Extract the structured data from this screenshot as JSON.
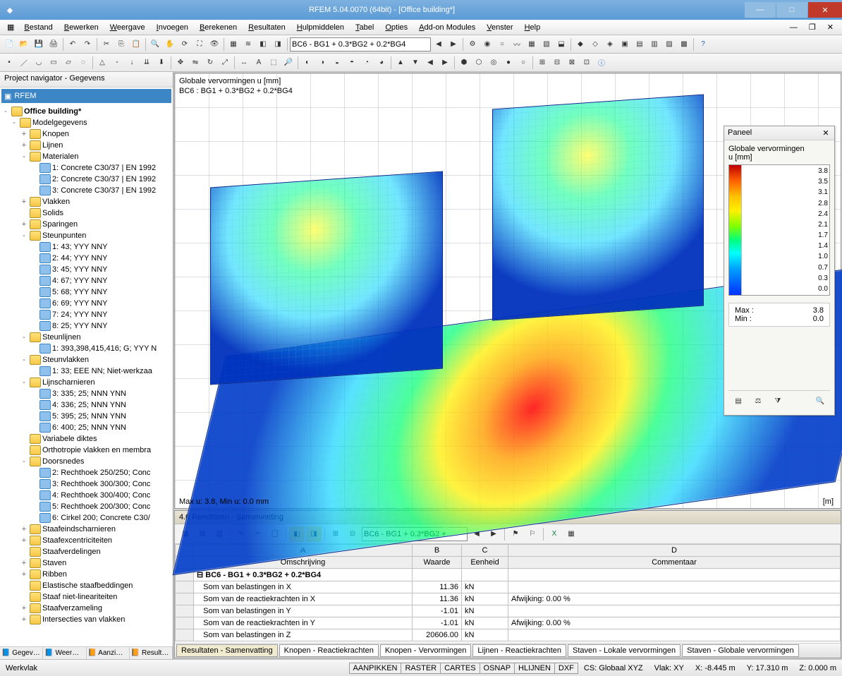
{
  "title": "RFEM 5.04.0070 (64bit) - [Office building*]",
  "menus": [
    "Bestand",
    "Bewerken",
    "Weergave",
    "Invoegen",
    "Berekenen",
    "Resultaten",
    "Hulpmiddelen",
    "Tabel",
    "Opties",
    "Add-on Modules",
    "Venster",
    "Help"
  ],
  "lc_combo": "BC6 - BG1 + 0.3*BG2 + 0.2*BG4",
  "navigator": {
    "title": "Project navigator - Gegevens",
    "root": "RFEM",
    "project": "Office building*",
    "items": [
      {
        "l": 1,
        "exp": "-",
        "ic": "folder",
        "t": "Modelgegevens"
      },
      {
        "l": 2,
        "exp": "+",
        "ic": "folder",
        "t": "Knopen"
      },
      {
        "l": 2,
        "exp": "+",
        "ic": "folder",
        "t": "Lijnen"
      },
      {
        "l": 2,
        "exp": "-",
        "ic": "folder",
        "t": "Materialen"
      },
      {
        "l": 3,
        "exp": "",
        "ic": "nic",
        "t": "1: Concrete C30/37 | EN 1992"
      },
      {
        "l": 3,
        "exp": "",
        "ic": "nic",
        "t": "2: Concrete C30/37 | EN 1992"
      },
      {
        "l": 3,
        "exp": "",
        "ic": "nic",
        "t": "3: Concrete C30/37 | EN 1992"
      },
      {
        "l": 2,
        "exp": "+",
        "ic": "folder",
        "t": "Vlakken"
      },
      {
        "l": 2,
        "exp": "",
        "ic": "folder",
        "t": "Solids"
      },
      {
        "l": 2,
        "exp": "+",
        "ic": "folder",
        "t": "Sparingen"
      },
      {
        "l": 2,
        "exp": "-",
        "ic": "folder",
        "t": "Steunpunten"
      },
      {
        "l": 3,
        "exp": "",
        "ic": "nic",
        "t": "1: 43; YYY NNY"
      },
      {
        "l": 3,
        "exp": "",
        "ic": "nic",
        "t": "2: 44; YYY NNY"
      },
      {
        "l": 3,
        "exp": "",
        "ic": "nic",
        "t": "3: 45; YYY NNY"
      },
      {
        "l": 3,
        "exp": "",
        "ic": "nic",
        "t": "4: 67; YYY NNY"
      },
      {
        "l": 3,
        "exp": "",
        "ic": "nic",
        "t": "5: 68; YYY NNY"
      },
      {
        "l": 3,
        "exp": "",
        "ic": "nic",
        "t": "6: 69; YYY NNY"
      },
      {
        "l": 3,
        "exp": "",
        "ic": "nic",
        "t": "7: 24; YYY NNY"
      },
      {
        "l": 3,
        "exp": "",
        "ic": "nic",
        "t": "8: 25; YYY NNY"
      },
      {
        "l": 2,
        "exp": "-",
        "ic": "folder",
        "t": "Steunlijnen"
      },
      {
        "l": 3,
        "exp": "",
        "ic": "nic",
        "t": "1: 393,398,415,416; G; YYY N"
      },
      {
        "l": 2,
        "exp": "-",
        "ic": "folder",
        "t": "Steunvlakken"
      },
      {
        "l": 3,
        "exp": "",
        "ic": "nic",
        "t": "1: 33; EEE NN; Niet-werkzaa"
      },
      {
        "l": 2,
        "exp": "-",
        "ic": "folder",
        "t": "Lijnscharnieren"
      },
      {
        "l": 3,
        "exp": "",
        "ic": "nic",
        "t": "3: 335; 25; NNN YNN"
      },
      {
        "l": 3,
        "exp": "",
        "ic": "nic",
        "t": "4: 336; 25; NNN YNN"
      },
      {
        "l": 3,
        "exp": "",
        "ic": "nic",
        "t": "5: 395; 25; NNN YNN"
      },
      {
        "l": 3,
        "exp": "",
        "ic": "nic",
        "t": "6: 400; 25; NNN YNN"
      },
      {
        "l": 2,
        "exp": "",
        "ic": "folder",
        "t": "Variabele diktes"
      },
      {
        "l": 2,
        "exp": "",
        "ic": "folder",
        "t": "Orthotropie vlakken en membra"
      },
      {
        "l": 2,
        "exp": "-",
        "ic": "folder",
        "t": "Doorsnedes"
      },
      {
        "l": 3,
        "exp": "",
        "ic": "nic",
        "t": "2: Rechthoek 250/250; Conc"
      },
      {
        "l": 3,
        "exp": "",
        "ic": "nic",
        "t": "3: Rechthoek 300/300; Conc"
      },
      {
        "l": 3,
        "exp": "",
        "ic": "nic",
        "t": "4: Rechthoek 300/400; Conc"
      },
      {
        "l": 3,
        "exp": "",
        "ic": "nic",
        "t": "5: Rechthoek 200/300; Conc"
      },
      {
        "l": 3,
        "exp": "",
        "ic": "nic",
        "t": "6: Cirkel 200; Concrete C30/"
      },
      {
        "l": 2,
        "exp": "+",
        "ic": "folder",
        "t": "Staafeindscharnieren"
      },
      {
        "l": 2,
        "exp": "+",
        "ic": "folder",
        "t": "Staafexcentriciteiten"
      },
      {
        "l": 2,
        "exp": "",
        "ic": "folder",
        "t": "Staafverdelingen"
      },
      {
        "l": 2,
        "exp": "+",
        "ic": "folder",
        "t": "Staven"
      },
      {
        "l": 2,
        "exp": "+",
        "ic": "folder",
        "t": "Ribben"
      },
      {
        "l": 2,
        "exp": "",
        "ic": "folder",
        "t": "Elastische staafbeddingen"
      },
      {
        "l": 2,
        "exp": "",
        "ic": "folder",
        "t": "Staaf niet-lineariteiten"
      },
      {
        "l": 2,
        "exp": "+",
        "ic": "folder",
        "t": "Staafverzameling"
      },
      {
        "l": 2,
        "exp": "+",
        "ic": "folder",
        "t": "Intersecties van vlakken"
      }
    ],
    "tabs": [
      "Gegev…",
      "Weer…",
      "Aanzi…",
      "Result…"
    ]
  },
  "view": {
    "title1": "Globale vervormingen u [mm]",
    "title2": "BC6 : BG1 + 0.3*BG2 + 0.2*BG4",
    "footL": "Max u: 3.8, Min u: 0.0 mm",
    "footR": "[m]"
  },
  "panel": {
    "title": "Paneel",
    "subtitle": "Globale vervormingen",
    "unit": "u [mm]",
    "ticks": [
      "3.8",
      "3.5",
      "3.1",
      "2.8",
      "2.4",
      "2.1",
      "1.7",
      "1.4",
      "1.0",
      "0.7",
      "0.3",
      "0.0"
    ],
    "max_label": "Max :",
    "max_val": "3.8",
    "min_label": "Min :",
    "min_val": "0.0"
  },
  "results": {
    "title": "4.0 Resultaten - Samenvatting",
    "combo": "BC6 - BG1 + 0.3*BG2 +",
    "colhead": {
      "A": "A",
      "B": "B",
      "C": "C",
      "D": "D"
    },
    "headers": {
      "desc": "Omschrijving",
      "val": "Waarde",
      "unit": "Eenheid",
      "comment": "Commentaar"
    },
    "rows": [
      {
        "group": true,
        "desc": "BC6 - BG1 + 0.3*BG2 + 0.2*BG4",
        "val": "",
        "unit": "",
        "comment": ""
      },
      {
        "desc": "Som van belastingen in X",
        "val": "11.36",
        "unit": "kN",
        "comment": ""
      },
      {
        "desc": "Som van de reactiekrachten in X",
        "val": "11.36",
        "unit": "kN",
        "comment": "Afwijking:  0.00 %"
      },
      {
        "desc": "Som van belastingen in Y",
        "val": "-1.01",
        "unit": "kN",
        "comment": ""
      },
      {
        "desc": "Som van de reactiekrachten in Y",
        "val": "-1.01",
        "unit": "kN",
        "comment": "Afwijking:  0.00 %"
      },
      {
        "desc": "Som van belastingen in Z",
        "val": "20606.00",
        "unit": "kN",
        "comment": ""
      }
    ],
    "tabs": [
      "Resultaten - Samenvatting",
      "Knopen - Reactiekrachten",
      "Knopen - Vervormingen",
      "Lijnen - Reactiekrachten",
      "Staven - Lokale vervormingen",
      "Staven - Globale vervormingen"
    ]
  },
  "statusbar": {
    "left": "Werkvlak",
    "btns": [
      "AANPIKKEN",
      "RASTER",
      "CARTES",
      "OSNAP",
      "HLIJNEN",
      "DXF"
    ],
    "cs": "CS: Globaal XYZ",
    "vlak": "Vlak: XY",
    "x": "X:  -8.445 m",
    "y": "Y:  17.310 m",
    "z": "Z:   0.000 m"
  }
}
